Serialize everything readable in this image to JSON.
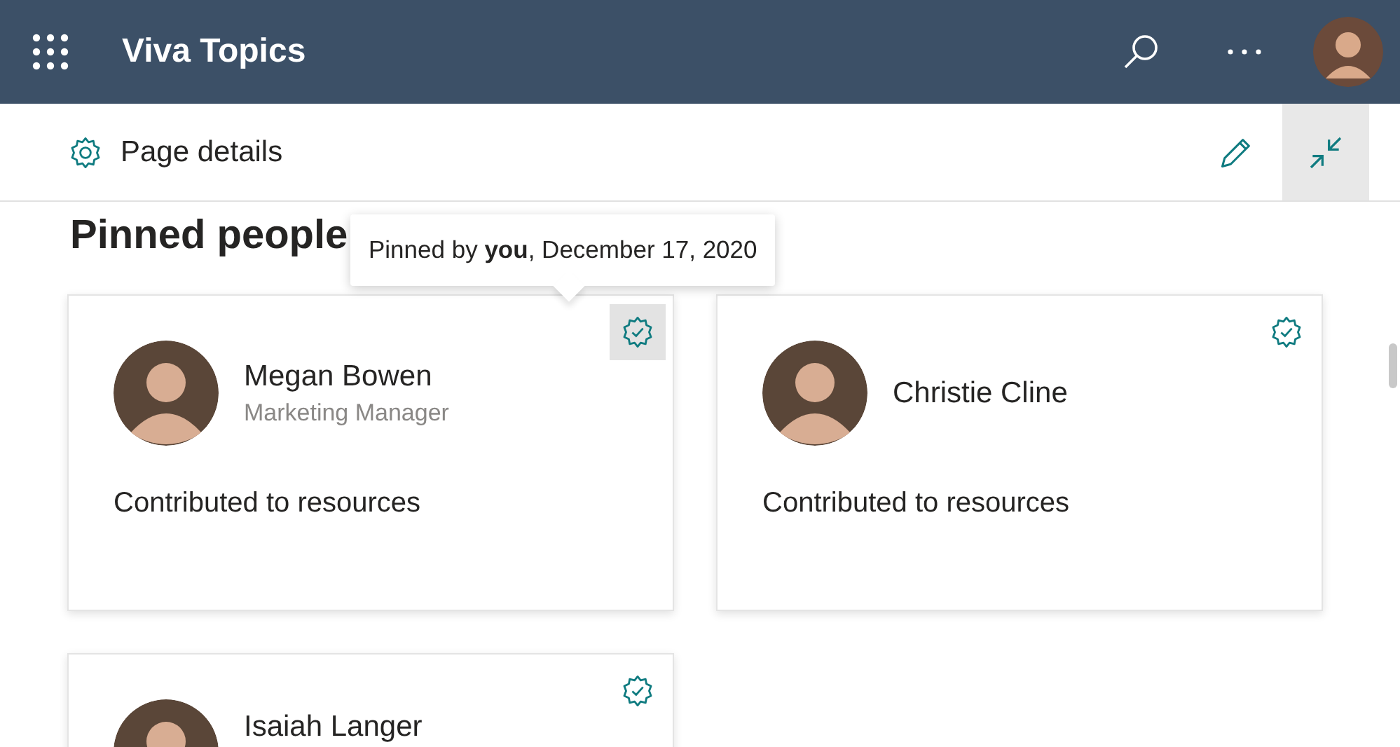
{
  "app_bar": {
    "title": "Viva Topics"
  },
  "page_bar": {
    "label": "Page details"
  },
  "section": {
    "title": "Pinned people"
  },
  "tooltip": {
    "text": "Pinned by **you**, December 17, 2020"
  },
  "people": [
    {
      "name": "Megan Bowen",
      "role": "Marketing Manager",
      "note": "Contributed to resources",
      "pin_hovered": true
    },
    {
      "name": "Christie Cline",
      "note": "Contributed to resources",
      "pin_hovered": false
    },
    {
      "name": "Isaiah Langer",
      "pin_hovered": false
    }
  ]
}
